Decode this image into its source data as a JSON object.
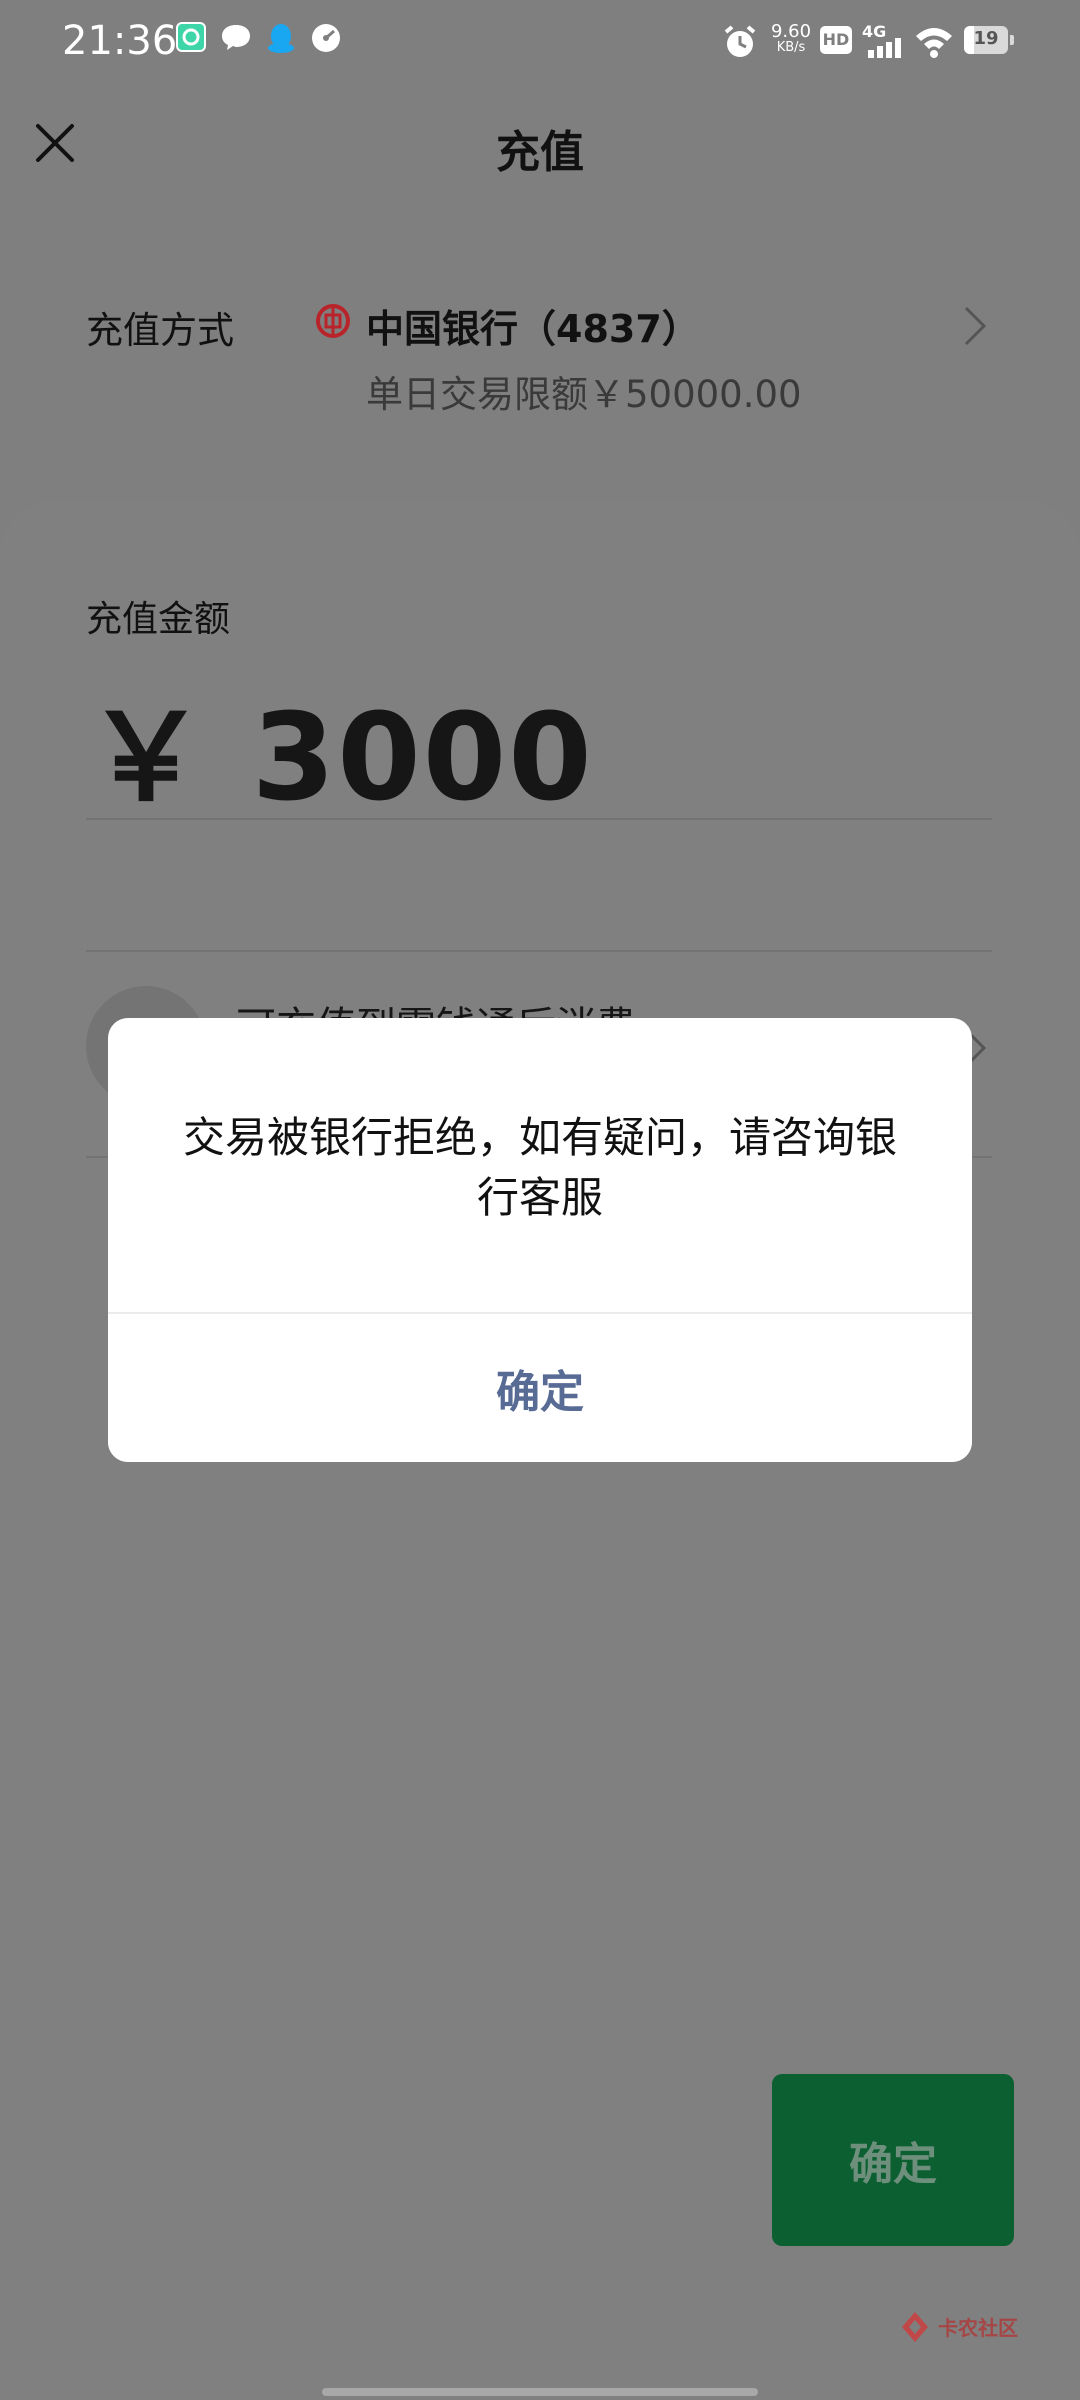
{
  "status_bar": {
    "time": "21:36",
    "left_icons": [
      "app-green-icon",
      "chat-bubble-icon",
      "qq-penguin-icon",
      "speedometer-icon"
    ],
    "net_speed_value": "9.60",
    "net_speed_unit": "KB/s",
    "hd_label": "HD",
    "network_label": "4G",
    "battery_level": "19",
    "right_icons": [
      "alarm-icon",
      "hd-icon",
      "signal-icon",
      "wifi-icon",
      "battery-icon"
    ]
  },
  "nav": {
    "title": "充值",
    "close_icon": "close-icon"
  },
  "payment_method": {
    "label": "充值方式",
    "bank_name": "中国银行（4837）",
    "daily_limit": "单日交易限额￥50000.00",
    "bank_logo_color": "#b8242a"
  },
  "amount": {
    "label": "充值金额",
    "value": "￥ 3000"
  },
  "option": {
    "text": "可充值到零钱通后消费"
  },
  "confirm_button": {
    "label": "确定",
    "color": "#0b5f31"
  },
  "dialog": {
    "message": "交易被银行拒绝，如有疑问，请咨询银行客服",
    "ok_label": "确定",
    "ok_color": "#576b95"
  },
  "watermark": {
    "text": "卡农社区"
  }
}
